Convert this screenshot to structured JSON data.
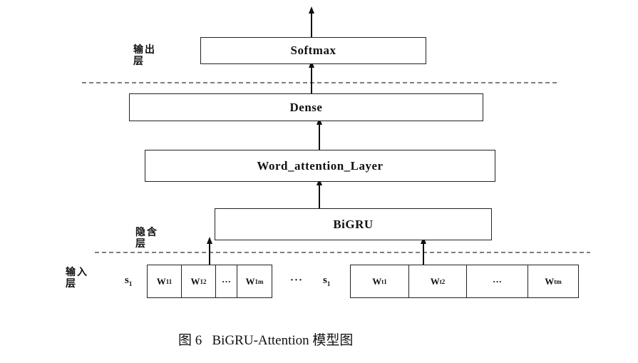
{
  "layers": {
    "softmax": "Softmax",
    "dense": "Dense",
    "attention": "Word_attention_Layer",
    "bigru": "BiGRU"
  },
  "labels": {
    "output_line1": "输出",
    "output_line2": "层",
    "hidden_line1": "隐含",
    "hidden_line2": "层",
    "input_line1": "输入",
    "input_line2": "层"
  },
  "sentence1": {
    "name": "s",
    "name_sub": "1",
    "words": [
      {
        "base": "W",
        "sub": "11"
      },
      {
        "base": "W",
        "sub": "12"
      },
      {
        "base": "···",
        "sub": ""
      },
      {
        "base": "W",
        "sub": "1m"
      }
    ]
  },
  "between_ellipsis": "···",
  "sentence2": {
    "name": "s",
    "name_sub": "1",
    "words": [
      {
        "base": "W",
        "sub": "t1"
      },
      {
        "base": "W",
        "sub": "t2"
      },
      {
        "base": "···",
        "sub": ""
      },
      {
        "base": "W",
        "sub": "tm"
      }
    ]
  },
  "caption": "图 6   BiGRU-Attention 模型图"
}
